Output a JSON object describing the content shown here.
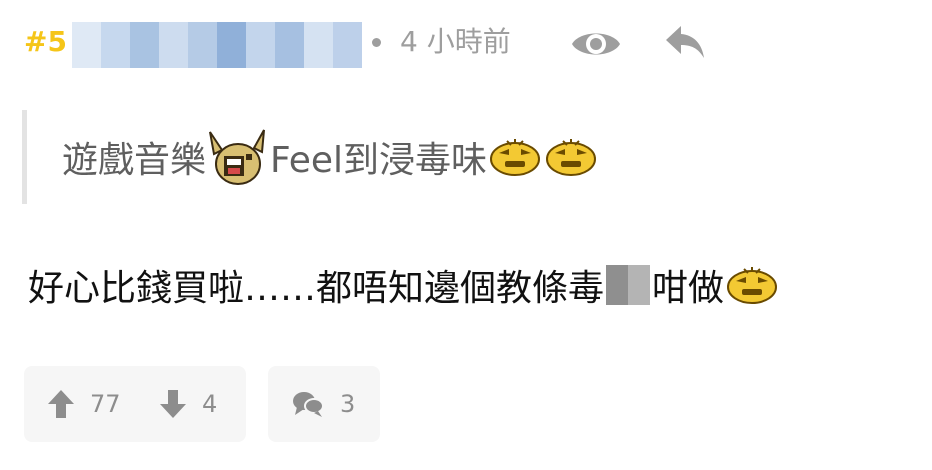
{
  "post": {
    "number": "#5",
    "time": "4 小時前"
  },
  "quote": {
    "text_before": "遊戲音樂",
    "text_middle": "Feel到浸毒味"
  },
  "body": {
    "text_before": "好心比錢買啦……都唔知邊個教條毒",
    "text_after": "咁做"
  },
  "footer": {
    "upvotes": "77",
    "downvotes": "4",
    "comments": "3"
  },
  "colors": {
    "post_number": "#f5c518",
    "meta_grey": "#9e9e9e",
    "quote_text": "#5f5f5f",
    "body_text": "#111111"
  },
  "icons": {
    "view": "eye-icon",
    "reply": "reply-arrow-icon",
    "upvote": "arrow-up-icon",
    "downvote": "arrow-down-icon",
    "comment": "speech-bubbles-icon"
  }
}
